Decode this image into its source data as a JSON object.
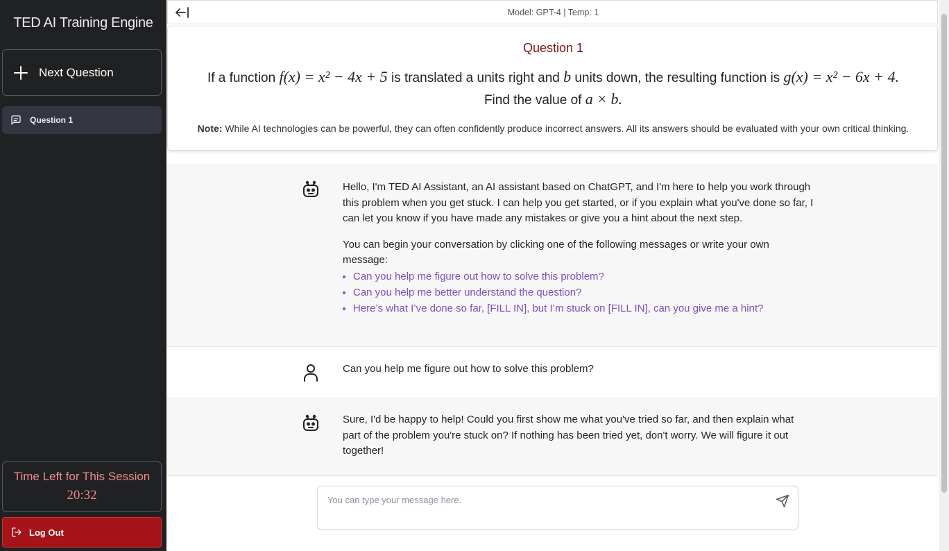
{
  "sidebar": {
    "app_title": "TED AI Training Engine",
    "next_question_label": "Next Question",
    "questions": [
      {
        "label": "Question 1"
      }
    ],
    "timer_label": "Time Left for This Session",
    "timer_value": "20:32",
    "logout_label": "Log Out"
  },
  "topbar": {
    "model_info": "Model: GPT-4 | Temp: 1"
  },
  "question": {
    "title": "Question 1",
    "text_1": "If a function ",
    "math_f": "f(x) = x² − 4x + 5",
    "text_2": " is translated a units right and ",
    "math_b": "b",
    "text_3": " units down, the resulting function is ",
    "math_g": "g(x) = x² − 6x + 4.",
    "text_4": "Find the value of ",
    "math_axb": "a × b.",
    "note_label": "Note:",
    "note_text": " While AI technologies can be powerful, they can often confidently produce incorrect answers. All its answers should be evaluated with your own critical thinking."
  },
  "chat": {
    "messages": [
      {
        "role": "bot",
        "p1": "Hello, I'm TED AI Assistant, an AI assistant based on ChatGPT, and I'm here to help you work through this problem when you get stuck. I can help you get started, or if you explain what you've done so far, I can let you know if you have made any mistakes or give you a hint about the next step.",
        "p2": "You can begin your conversation by clicking one of the following messages or write your own message:",
        "suggestions": [
          "Can you help me figure out how to solve this problem?",
          "Can you help me better understand the question?",
          "Here’s what I’ve done so far, [FILL IN], but I’m stuck on [FILL IN], can you give me a hint?"
        ]
      },
      {
        "role": "user",
        "text": "Can you help me figure out how to solve this problem?"
      },
      {
        "role": "bot",
        "text": "Sure, I'd be happy to help! Could you first show me what you've tried so far, and then explain what part of the problem you're stuck on? If nothing has been tried yet, don't worry. We will figure it out together!"
      }
    ]
  },
  "input": {
    "placeholder": "You can type your message here.",
    "value": ""
  },
  "icons": {
    "back": "arrow-left-bar-icon",
    "plus": "plus-icon",
    "chat": "message-square-icon",
    "logout": "log-out-icon",
    "bot": "robot-icon",
    "user": "user-icon",
    "send": "send-icon"
  },
  "colors": {
    "sidebar_bg": "#202123",
    "question_title": "#8b1010",
    "timer_text": "#f08a8a",
    "logout_bg": "#a61318",
    "suggestion_link": "#7b4fc0"
  }
}
